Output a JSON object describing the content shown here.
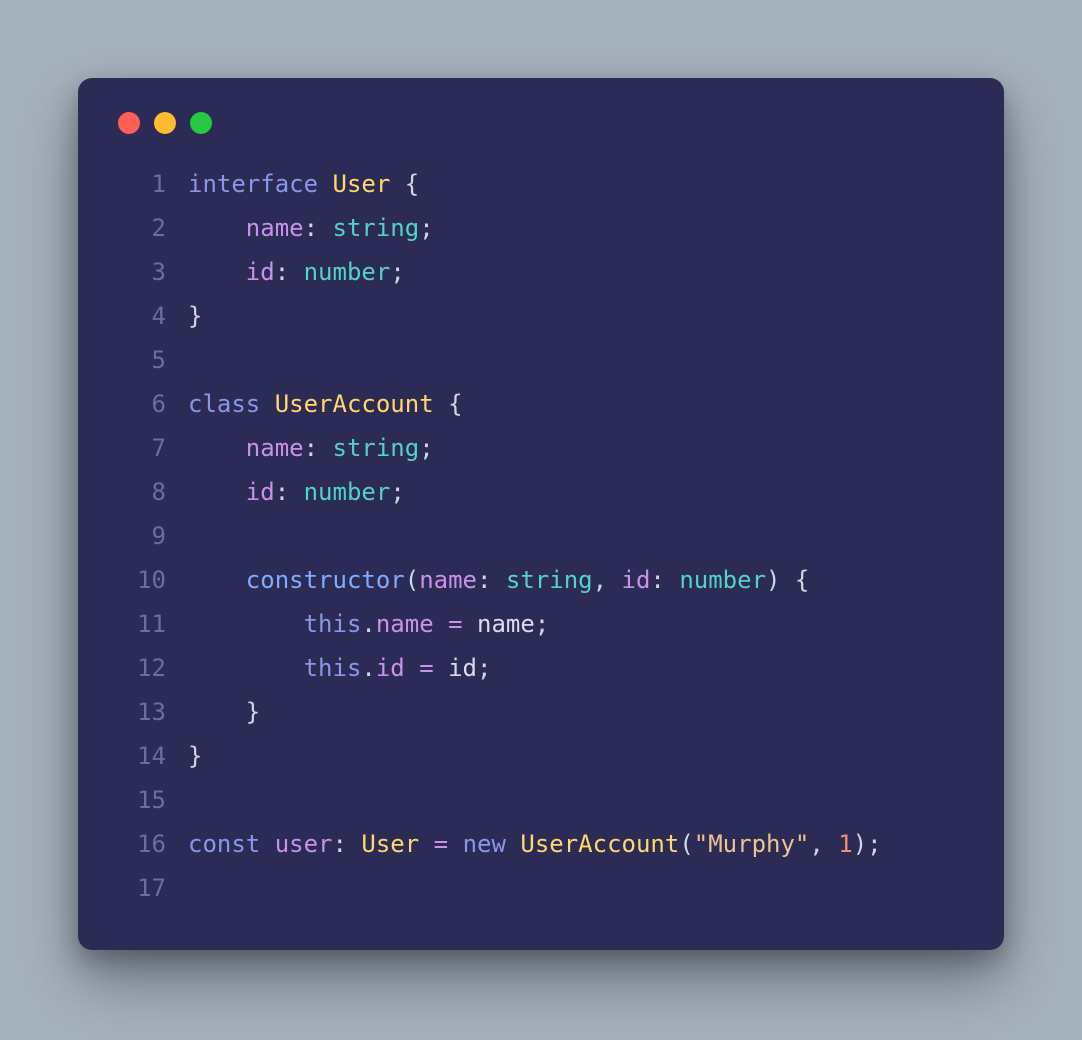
{
  "window": {
    "traffic_lights": [
      "close",
      "minimize",
      "zoom"
    ]
  },
  "code": {
    "language": "typescript",
    "lines": [
      {
        "n": "1",
        "tokens": [
          {
            "t": "interface",
            "c": "tok-kw"
          },
          {
            "t": " ",
            "c": "tok-plain"
          },
          {
            "t": "User",
            "c": "tok-class"
          },
          {
            "t": " {",
            "c": "tok-punc"
          }
        ]
      },
      {
        "n": "2",
        "tokens": [
          {
            "t": "    ",
            "c": "tok-plain"
          },
          {
            "t": "name",
            "c": "tok-prop"
          },
          {
            "t": ": ",
            "c": "tok-punc"
          },
          {
            "t": "string",
            "c": "tok-type"
          },
          {
            "t": ";",
            "c": "tok-punc"
          }
        ]
      },
      {
        "n": "3",
        "tokens": [
          {
            "t": "    ",
            "c": "tok-plain"
          },
          {
            "t": "id",
            "c": "tok-prop"
          },
          {
            "t": ": ",
            "c": "tok-punc"
          },
          {
            "t": "number",
            "c": "tok-type"
          },
          {
            "t": ";",
            "c": "tok-punc"
          }
        ]
      },
      {
        "n": "4",
        "tokens": [
          {
            "t": "}",
            "c": "tok-punc"
          }
        ]
      },
      {
        "n": "5",
        "tokens": []
      },
      {
        "n": "6",
        "tokens": [
          {
            "t": "class",
            "c": "tok-kw"
          },
          {
            "t": " ",
            "c": "tok-plain"
          },
          {
            "t": "UserAccount",
            "c": "tok-class"
          },
          {
            "t": " {",
            "c": "tok-punc"
          }
        ]
      },
      {
        "n": "7",
        "tokens": [
          {
            "t": "    ",
            "c": "tok-plain"
          },
          {
            "t": "name",
            "c": "tok-prop"
          },
          {
            "t": ": ",
            "c": "tok-punc"
          },
          {
            "t": "string",
            "c": "tok-type"
          },
          {
            "t": ";",
            "c": "tok-punc"
          }
        ]
      },
      {
        "n": "8",
        "tokens": [
          {
            "t": "    ",
            "c": "tok-plain"
          },
          {
            "t": "id",
            "c": "tok-prop"
          },
          {
            "t": ": ",
            "c": "tok-punc"
          },
          {
            "t": "number",
            "c": "tok-type"
          },
          {
            "t": ";",
            "c": "tok-punc"
          }
        ]
      },
      {
        "n": "9",
        "tokens": []
      },
      {
        "n": "10",
        "tokens": [
          {
            "t": "    ",
            "c": "tok-plain"
          },
          {
            "t": "constructor",
            "c": "tok-func"
          },
          {
            "t": "(",
            "c": "tok-punc"
          },
          {
            "t": "name",
            "c": "tok-prop"
          },
          {
            "t": ": ",
            "c": "tok-punc"
          },
          {
            "t": "string",
            "c": "tok-type"
          },
          {
            "t": ", ",
            "c": "tok-punc"
          },
          {
            "t": "id",
            "c": "tok-prop"
          },
          {
            "t": ": ",
            "c": "tok-punc"
          },
          {
            "t": "number",
            "c": "tok-type"
          },
          {
            "t": ") {",
            "c": "tok-punc"
          }
        ]
      },
      {
        "n": "11",
        "tokens": [
          {
            "t": "        ",
            "c": "tok-plain"
          },
          {
            "t": "this",
            "c": "tok-kw"
          },
          {
            "t": ".",
            "c": "tok-punc"
          },
          {
            "t": "name",
            "c": "tok-prop"
          },
          {
            "t": " ",
            "c": "tok-plain"
          },
          {
            "t": "=",
            "c": "tok-op"
          },
          {
            "t": " name",
            "c": "tok-plain"
          },
          {
            "t": ";",
            "c": "tok-punc"
          }
        ]
      },
      {
        "n": "12",
        "tokens": [
          {
            "t": "        ",
            "c": "tok-plain"
          },
          {
            "t": "this",
            "c": "tok-kw"
          },
          {
            "t": ".",
            "c": "tok-punc"
          },
          {
            "t": "id",
            "c": "tok-prop"
          },
          {
            "t": " ",
            "c": "tok-plain"
          },
          {
            "t": "=",
            "c": "tok-op"
          },
          {
            "t": " id",
            "c": "tok-plain"
          },
          {
            "t": ";",
            "c": "tok-punc"
          }
        ]
      },
      {
        "n": "13",
        "tokens": [
          {
            "t": "    }",
            "c": "tok-punc"
          }
        ]
      },
      {
        "n": "14",
        "tokens": [
          {
            "t": "}",
            "c": "tok-punc"
          }
        ]
      },
      {
        "n": "15",
        "tokens": []
      },
      {
        "n": "16",
        "tokens": [
          {
            "t": "const",
            "c": "tok-kw"
          },
          {
            "t": " ",
            "c": "tok-plain"
          },
          {
            "t": "user",
            "c": "tok-ident"
          },
          {
            "t": ": ",
            "c": "tok-punc"
          },
          {
            "t": "User",
            "c": "tok-class"
          },
          {
            "t": " ",
            "c": "tok-plain"
          },
          {
            "t": "=",
            "c": "tok-op"
          },
          {
            "t": " ",
            "c": "tok-plain"
          },
          {
            "t": "new",
            "c": "tok-kw"
          },
          {
            "t": " ",
            "c": "tok-plain"
          },
          {
            "t": "UserAccount",
            "c": "tok-class"
          },
          {
            "t": "(",
            "c": "tok-punc"
          },
          {
            "t": "\"Murphy\"",
            "c": "tok-str"
          },
          {
            "t": ", ",
            "c": "tok-punc"
          },
          {
            "t": "1",
            "c": "tok-num"
          },
          {
            "t": ");",
            "c": "tok-punc"
          }
        ]
      },
      {
        "n": "17",
        "tokens": []
      }
    ]
  }
}
